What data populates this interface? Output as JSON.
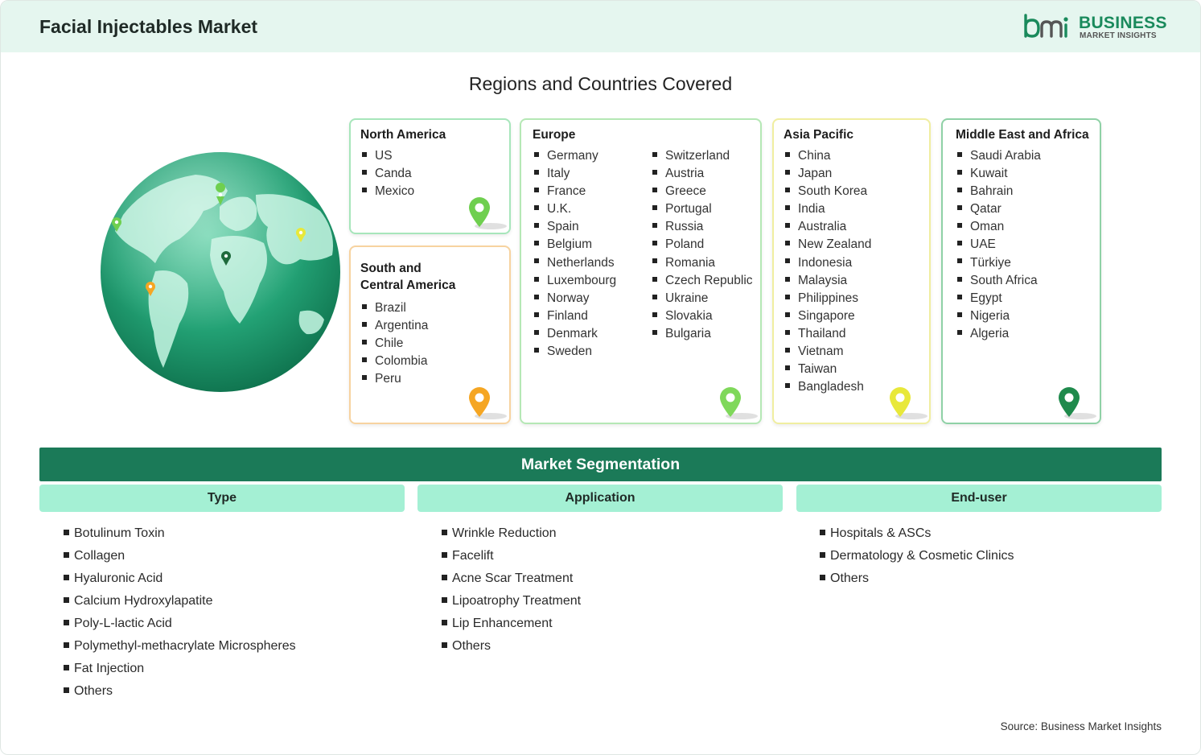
{
  "header": {
    "title": "Facial Injectables Market",
    "logo_name": "BUSINESS",
    "logo_sub": "MARKET INSIGHTS"
  },
  "regions_title": "Regions and Countries Covered",
  "regions": {
    "north_america": {
      "title": "North America",
      "countries": [
        "US",
        "Canda",
        "Mexico"
      ],
      "color": "#6fcf4f"
    },
    "south_central_america": {
      "title_line1": "South and",
      "title_line2": "Central America",
      "countries": [
        "Brazil",
        "Argentina",
        "Chile",
        "Colombia",
        "Peru"
      ],
      "color": "#f5a623"
    },
    "europe": {
      "title": "Europe",
      "countries_col1": [
        "Germany",
        "Italy",
        "France",
        "U.K.",
        "Spain",
        "Belgium",
        "Netherlands",
        "Luxembourg",
        "Norway",
        "Finland",
        "Denmark",
        "Sweden"
      ],
      "countries_col2": [
        "Switzerland",
        "Austria",
        "Greece",
        "Portugal",
        "Russia",
        "Poland",
        "Romania",
        "Czech Republic",
        "Ukraine",
        "Slovakia",
        "Bulgaria"
      ],
      "color": "#7fd85a"
    },
    "asia_pacific": {
      "title": "Asia Pacific",
      "countries": [
        "China",
        "Japan",
        "South Korea",
        "India",
        "Australia",
        "New Zealand",
        "Indonesia",
        "Malaysia",
        "Philippines",
        "Singapore",
        "Thailand",
        "Vietnam",
        "Taiwan",
        "Bangladesh"
      ],
      "color": "#e8e83a"
    },
    "middle_east_africa": {
      "title": "Middle East and Africa",
      "countries": [
        "Saudi Arabia",
        "Kuwait",
        "Bahrain",
        "Qatar",
        "Oman",
        "UAE",
        "Türkiye",
        "South Africa",
        "Egypt",
        "Nigeria",
        "Algeria"
      ],
      "color": "#1f8a4c"
    }
  },
  "segmentation": {
    "title": "Market Segmentation",
    "type": {
      "heading": "Type",
      "items": [
        "Botulinum Toxin",
        "Collagen",
        "Hyaluronic Acid",
        "Calcium Hydroxylapatite",
        "Poly-L-lactic Acid",
        "Polymethyl-methacrylate Microspheres",
        "Fat Injection",
        "Others"
      ]
    },
    "application": {
      "heading": "Application",
      "items": [
        "Wrinkle Reduction",
        "Facelift",
        "Acne Scar Treatment",
        "Lipoatrophy Treatment",
        "Lip Enhancement",
        "Others"
      ]
    },
    "end_user": {
      "heading": "End-user",
      "items": [
        "Hospitals & ASCs",
        "Dermatology & Cosmetic Clinics",
        "Others"
      ]
    }
  },
  "source": "Source: Business Market Insights",
  "icons": {
    "globe": "globe-icon",
    "pin": "location-pin-icon",
    "logo": "bmi-logo-icon"
  },
  "colors": {
    "header_bg": "#e5f6ef",
    "segmentation_bar": "#1b7a58",
    "segment_heading": "#a4f0d4",
    "brand_green": "#1a8a5c"
  }
}
